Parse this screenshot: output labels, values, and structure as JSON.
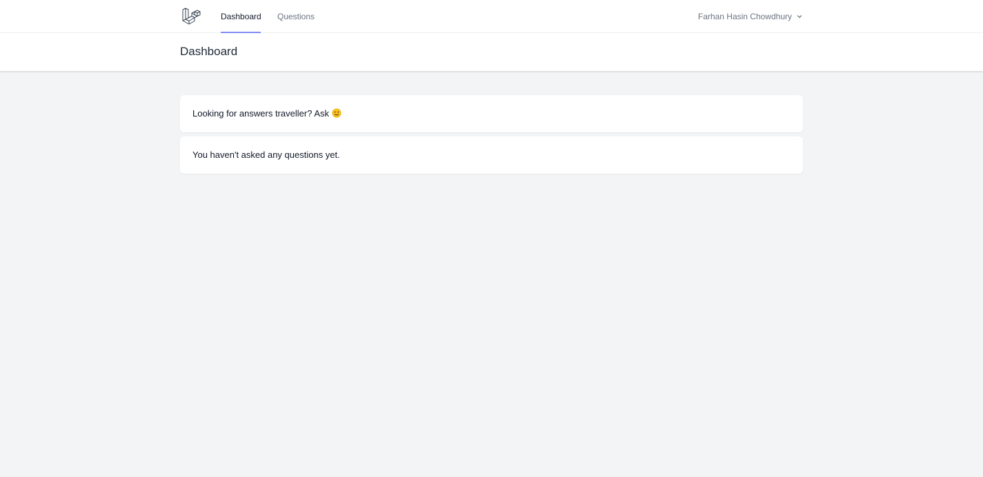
{
  "nav": {
    "logo_icon": "laravel-logo-icon",
    "links": [
      {
        "label": "Dashboard",
        "active": true
      },
      {
        "label": "Questions",
        "active": false
      }
    ],
    "user_name": "Farhan Hasin Chowdhury",
    "dropdown_icon": "chevron-down-icon"
  },
  "header": {
    "title": "Dashboard"
  },
  "cards": {
    "ask_text": "Looking for answers traveller? Ask",
    "ask_emoji_icon": "winking-face-icon",
    "empty_text": "You haven't asked any questions yet."
  },
  "colors": {
    "active_underline": "#818cf8",
    "background": "#f3f4f6",
    "nav_text": "#6b7280"
  }
}
